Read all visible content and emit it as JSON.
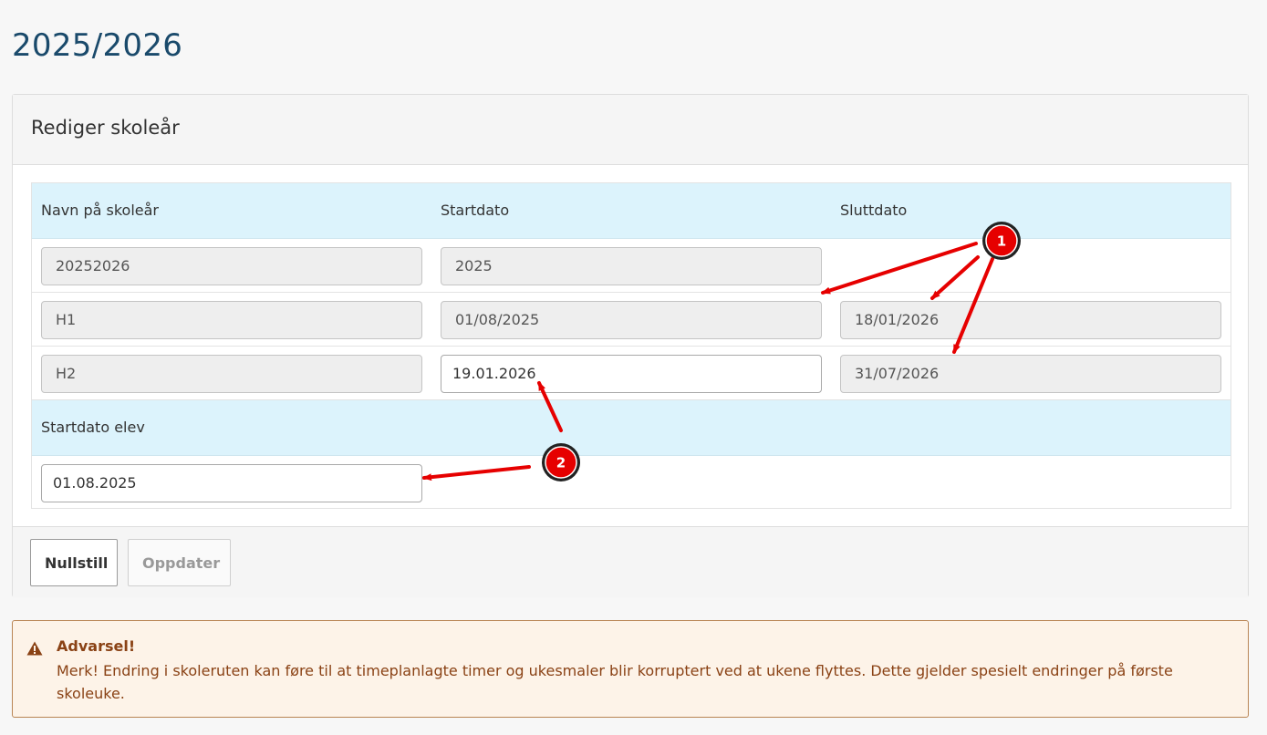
{
  "page": {
    "title": "2025/2026"
  },
  "panel": {
    "title": "Rediger skoleår",
    "columns": {
      "name": "Navn på skoleår",
      "start": "Startdato",
      "end": "Sluttdato"
    },
    "rows": [
      {
        "name": "20252026",
        "start": "2025",
        "end": ""
      },
      {
        "name": "H1",
        "start": "01/08/2025",
        "end": "18/01/2026"
      },
      {
        "name": "H2",
        "start": "19.01.2026",
        "end": "31/07/2026"
      }
    ],
    "student_start": {
      "label": "Startdato elev",
      "value": "01.08.2025"
    },
    "buttons": {
      "reset": "Nullstill",
      "update": "Oppdater"
    }
  },
  "alert": {
    "title": "Advarsel!",
    "message": "Merk! Endring i skoleruten kan føre til at timeplanlagte timer og ukesmaler blir korruptert ved at ukene flyttes. Dette gjelder spesielt endringer på første skoleuke."
  },
  "annotations": {
    "badge_1": "1",
    "badge_2": "2",
    "arrow_color": "#e60000"
  },
  "colors": {
    "header_bg": "#dcf3fc",
    "title": "#1a4a6b",
    "alert_text": "#8a4215",
    "alert_bg": "#fdf3e8"
  }
}
